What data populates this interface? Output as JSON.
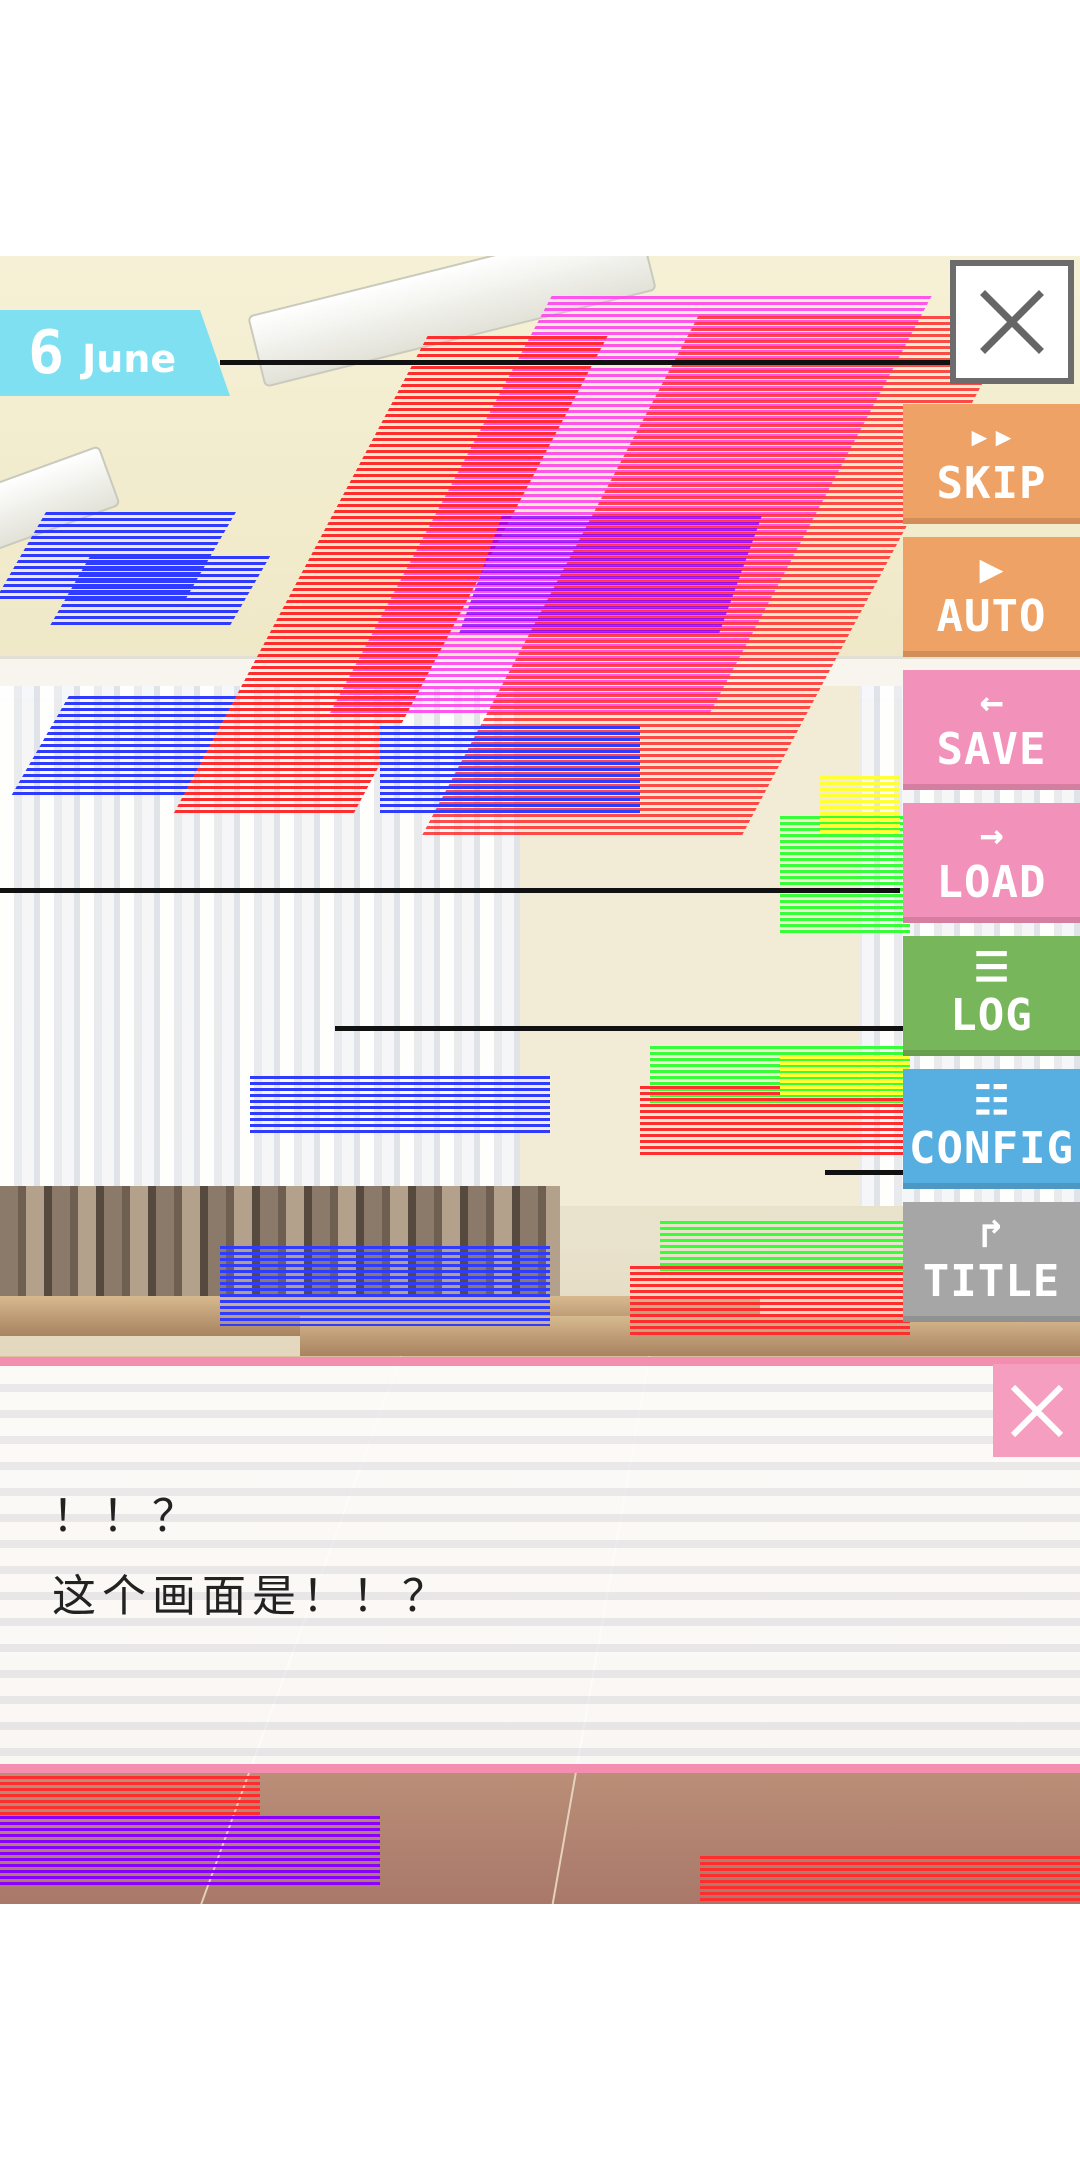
{
  "date": {
    "day": "6",
    "month": "June"
  },
  "side_menu": [
    {
      "id": "skip",
      "icon": "▸▸",
      "label": "SKIP",
      "color": "#eea265"
    },
    {
      "id": "auto",
      "icon": "▶",
      "label": "AUTO",
      "color": "#eea265"
    },
    {
      "id": "save",
      "icon": "←",
      "label": "SAVE",
      "color": "#f291b9"
    },
    {
      "id": "load",
      "icon": "→",
      "label": "LOAD",
      "color": "#f291b9"
    },
    {
      "id": "log",
      "icon": "☰",
      "label": "LOG",
      "color": "#77b65a"
    },
    {
      "id": "config",
      "icon": "☷",
      "label": "CONFIG",
      "color": "#57aee0"
    },
    {
      "id": "title",
      "icon": "↱",
      "label": "TITLE",
      "color": "#a6a6a6"
    }
  ],
  "dialogue": {
    "line1": "！！？",
    "line2": "这个画面是！！？"
  },
  "colors": {
    "date_banner": "#7fe0f2",
    "dialogue_border": "#f38eb0",
    "dialogue_close": "#f59ebf"
  }
}
